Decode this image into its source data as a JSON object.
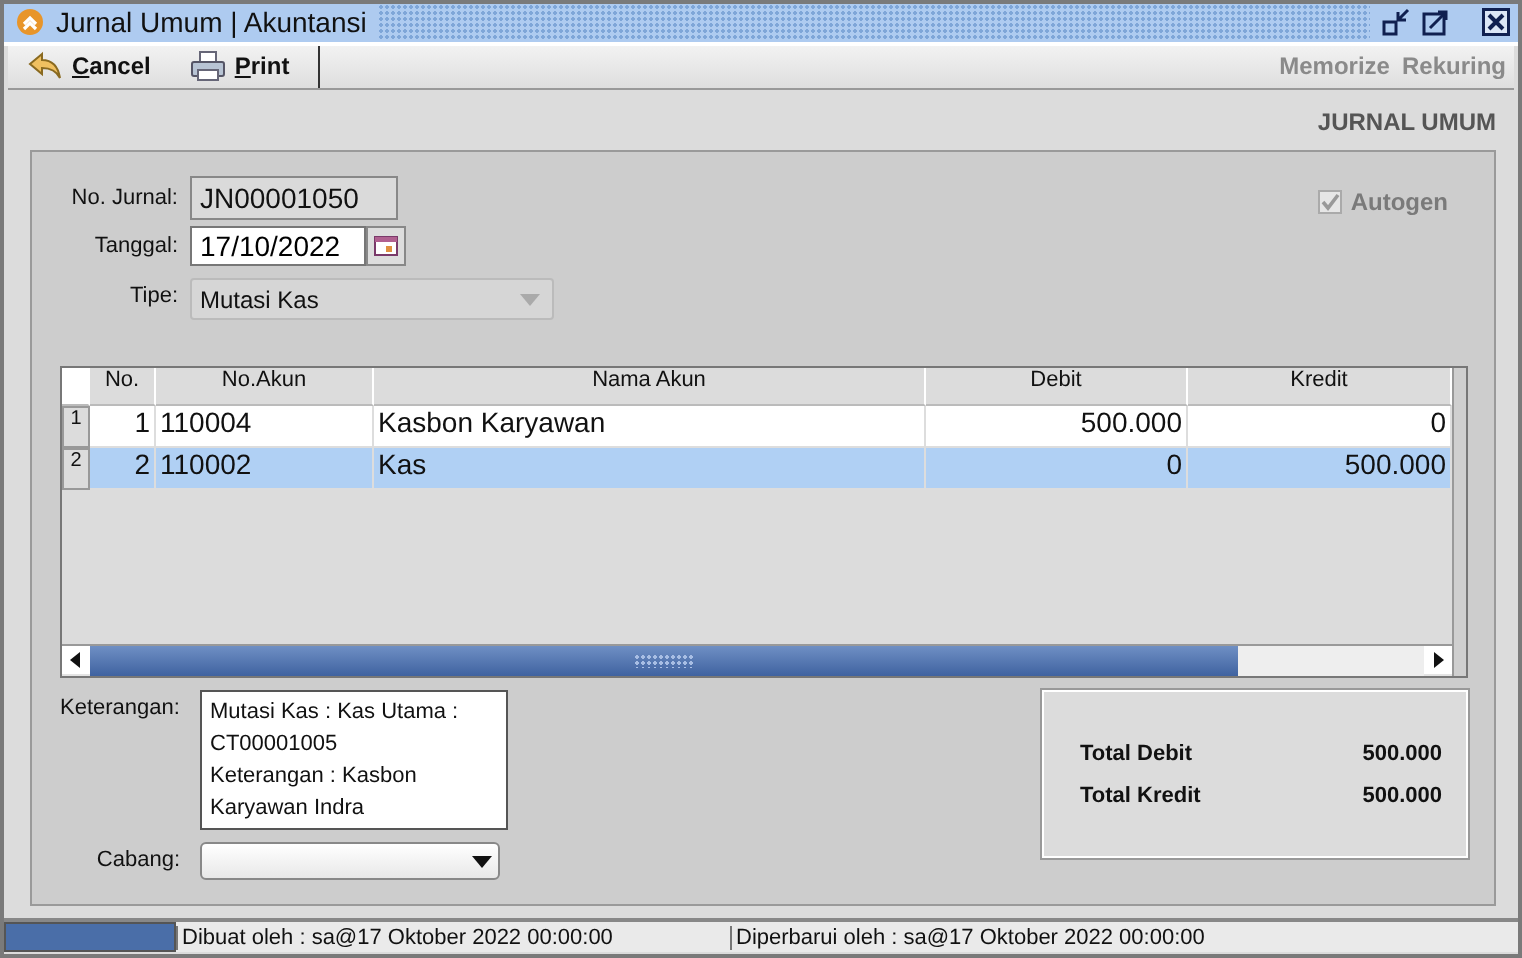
{
  "window": {
    "title": "Jurnal Umum | Akuntansi"
  },
  "toolbar": {
    "left": [
      {
        "label": "Cancel",
        "kind": "cancel"
      },
      {
        "label": "Print",
        "kind": "print"
      }
    ],
    "right": [
      {
        "label": "Memorize",
        "disabled": true
      },
      {
        "label": "Rekuring",
        "disabled": true
      }
    ]
  },
  "heading": "JURNAL UMUM",
  "form": {
    "no_jurnal": {
      "label": "No. Jurnal:",
      "value": "JN00001050"
    },
    "tanggal": {
      "label": "Tanggal:",
      "value": "17/10/2022"
    },
    "tipe": {
      "label": "Tipe:",
      "value": "Mutasi Kas",
      "disabled": true
    },
    "autogen": {
      "label": "Autogen",
      "checked": true,
      "disabled": true
    }
  },
  "table": {
    "columns": [
      "No.",
      "No.Akun",
      "Nama Akun",
      "Debit",
      "Kredit"
    ],
    "rows": [
      {
        "index": "1",
        "no": "1",
        "akun": "110004",
        "nama": "Kasbon Karyawan",
        "debit": "500.000",
        "kredit": "0",
        "selected": false
      },
      {
        "index": "2",
        "no": "2",
        "akun": "110002",
        "nama": "Kas",
        "debit": "0",
        "kredit": "500.000",
        "selected": true
      }
    ]
  },
  "keterangan": {
    "label": "Keterangan:",
    "lines": [
      "Mutasi Kas : Kas Utama :",
      "CT00001005",
      "Keterangan : Kasbon",
      "Karyawan Indra"
    ]
  },
  "cabang": {
    "label": "Cabang:"
  },
  "totals": [
    {
      "label": "Total Debit",
      "value": "500.000"
    },
    {
      "label": "Total Kredit",
      "value": "500.000"
    }
  ],
  "status_bar": [
    "Dibuat oleh : sa@17 Oktober 2022  00:00:00",
    "Diperbarui oleh : sa@17 Oktober 2022  00:00:00"
  ]
}
